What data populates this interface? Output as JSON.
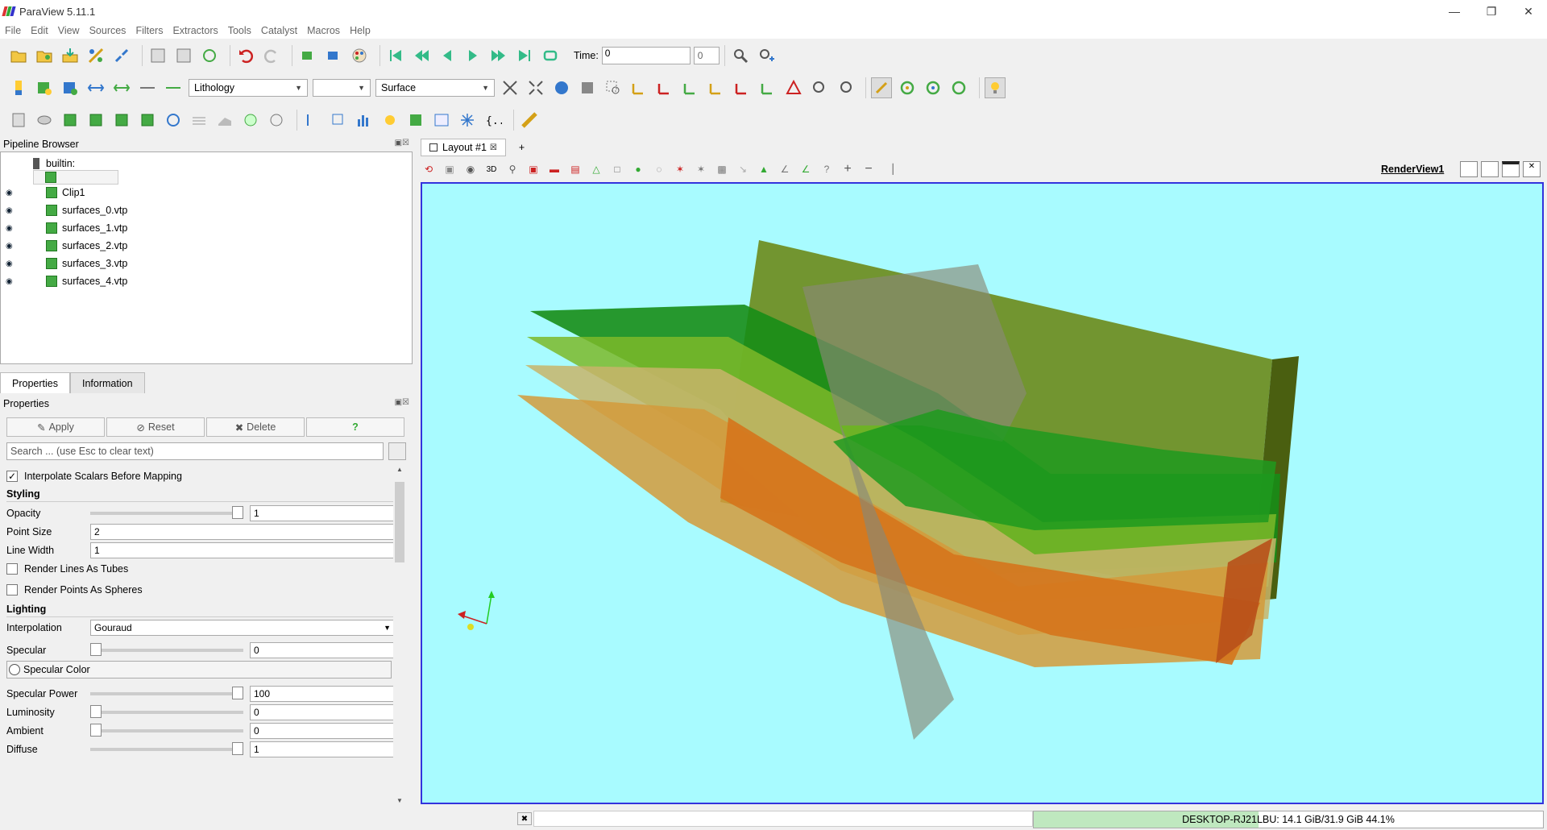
{
  "window": {
    "title": "ParaView 5.11.1"
  },
  "menu": [
    "File",
    "Edit",
    "View",
    "Sources",
    "Filters",
    "Extractors",
    "Tools",
    "Catalyst",
    "Macros",
    "Help"
  ],
  "time": {
    "label": "Time:",
    "value": "0",
    "index": "0"
  },
  "color_by": {
    "value": "Lithology"
  },
  "component": {
    "value": ""
  },
  "representation": {
    "value": "Surface"
  },
  "pipeline": {
    "title": "Pipeline Browser",
    "root": "builtin:",
    "items": [
      "Clip1",
      "surfaces_0.vtp",
      "surfaces_1.vtp",
      "surfaces_2.vtp",
      "surfaces_3.vtp",
      "surfaces_4.vtp"
    ]
  },
  "tabs": {
    "properties": "Properties",
    "information": "Information"
  },
  "properties": {
    "title": "Properties",
    "apply": "Apply",
    "reset": "Reset",
    "delete": "Delete",
    "help": "?",
    "search_placeholder": "Search ... (use Esc to clear text)",
    "interpolate": "Interpolate Scalars Before Mapping",
    "styling": "Styling",
    "opacity_label": "Opacity",
    "opacity": "1",
    "point_size_label": "Point Size",
    "point_size": "2",
    "line_width_label": "Line Width",
    "line_width": "1",
    "render_lines": "Render Lines As Tubes",
    "render_points": "Render Points As Spheres",
    "lighting": "Lighting",
    "interp_label": "Interpolation",
    "interp": "Gouraud",
    "specular_label": "Specular",
    "specular": "0",
    "specular_color": "Specular Color",
    "specular_power_label": "Specular Power",
    "specular_power": "100",
    "luminosity_label": "Luminosity",
    "luminosity": "0",
    "ambient_label": "Ambient",
    "ambient": "0",
    "diffuse_label": "Diffuse",
    "diffuse": "1"
  },
  "layout": {
    "tab": "Layout #1",
    "add": "+",
    "view_name": "RenderView1",
    "view_3d": "3D"
  },
  "status": {
    "memory": "DESKTOP-RJ21LBU: 14.1 GiB/31.9 GiB 44.1%",
    "memory_fraction": 0.441
  }
}
